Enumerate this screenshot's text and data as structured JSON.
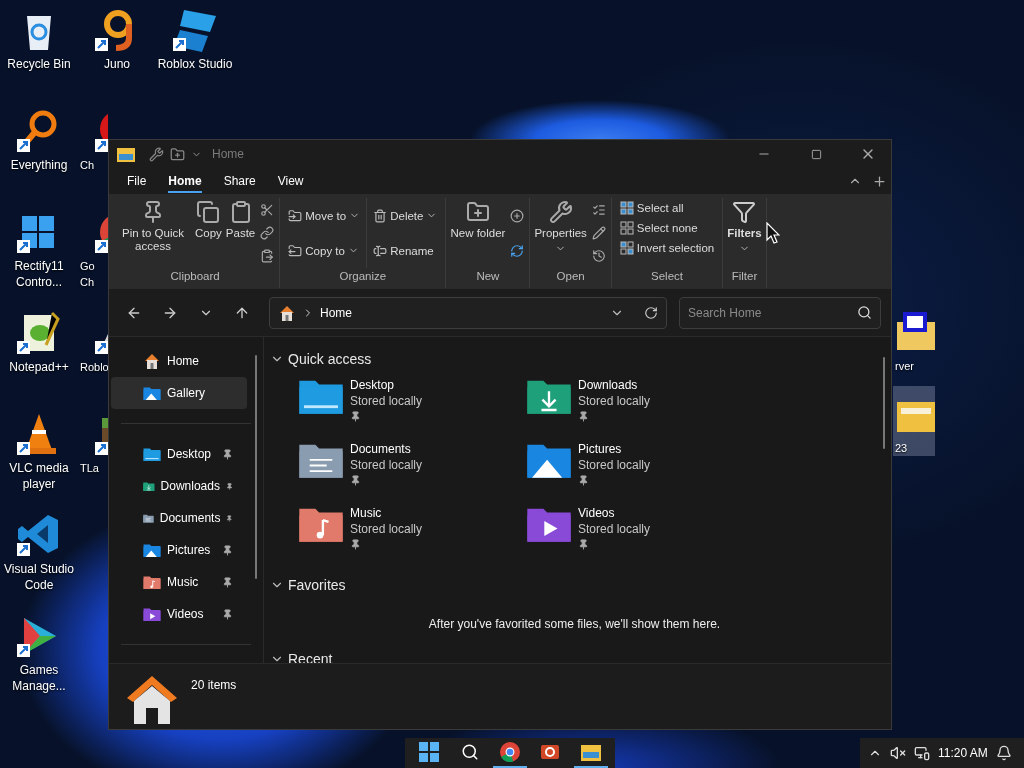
{
  "desktop": {
    "columns": [
      [
        {
          "label": "Recycle Bin",
          "kind": "bin",
          "shortcut": false,
          "clipped": false
        },
        {
          "label": "Everything",
          "kind": "everything",
          "shortcut": true,
          "clipped": false
        },
        {
          "label": "Rectify11 Contro...",
          "kind": "windows",
          "shortcut": true,
          "clipped": false
        },
        {
          "label": "Notepad++",
          "kind": "notepad",
          "shortcut": true,
          "clipped": false
        },
        {
          "label": "VLC media player",
          "kind": "vlc",
          "shortcut": true,
          "clipped": false
        },
        {
          "label": "Visual Studio Code",
          "kind": "vscode",
          "shortcut": true,
          "clipped": false
        },
        {
          "label": "Games Manage...",
          "kind": "games",
          "shortcut": true,
          "clipped": false
        }
      ],
      [
        {
          "label": "Juno",
          "kind": "juno",
          "shortcut": true,
          "clipped": false
        },
        {
          "label": "Ch",
          "kind": "red",
          "shortcut": true,
          "clipped": true
        },
        {
          "label": "Go Ch",
          "kind": "chrome",
          "shortcut": true,
          "clipped": true
        },
        {
          "label": "Roblo",
          "kind": "triangle",
          "shortcut": true,
          "clipped": true
        },
        {
          "label": "TLa",
          "kind": "cube",
          "shortcut": true,
          "clipped": true
        }
      ],
      [
        {
          "label": "Roblox Studio",
          "kind": "roblox",
          "shortcut": true,
          "clipped": false
        }
      ]
    ],
    "right_edge": [
      {
        "label": "rver",
        "kind": "zfolder",
        "selected": false
      },
      {
        "label": "23",
        "kind": "folder",
        "selected": true
      }
    ]
  },
  "window": {
    "title": "Home",
    "tabs": [
      {
        "label": "File",
        "selected": false
      },
      {
        "label": "Home",
        "selected": true
      },
      {
        "label": "Share",
        "selected": false
      },
      {
        "label": "View",
        "selected": false
      }
    ],
    "ribbon": [
      {
        "label": "Clipboard",
        "kind": "clipboard",
        "buttons": [
          "Pin to Quick access",
          "Copy",
          "Paste"
        ]
      },
      {
        "label": "Organize",
        "kind": "organize",
        "buttons": [
          "Move to",
          "Copy to",
          "Delete",
          "Rename"
        ]
      },
      {
        "label": "New",
        "kind": "new",
        "buttons": [
          "New folder"
        ]
      },
      {
        "label": "Open",
        "kind": "open",
        "buttons": [
          "Properties"
        ]
      },
      {
        "label": "Select",
        "kind": "select",
        "buttons": [
          "Select all",
          "Select none",
          "Invert selection"
        ]
      },
      {
        "label": "Filter",
        "kind": "filter",
        "buttons": [
          "Filters"
        ]
      }
    ],
    "address": {
      "location": "Home"
    },
    "search": {
      "placeholder": "Search Home"
    },
    "sidebar": {
      "groups": [
        {
          "items": [
            {
              "label": "Home",
              "kind": "home",
              "selected": false,
              "pinned": false
            },
            {
              "label": "Gallery",
              "kind": "pictures",
              "selected": true,
              "pinned": false
            }
          ]
        },
        {
          "items": [
            {
              "label": "Desktop",
              "kind": "desktop",
              "selected": false,
              "pinned": true
            },
            {
              "label": "Downloads",
              "kind": "downloads",
              "selected": false,
              "pinned": true
            },
            {
              "label": "Documents",
              "kind": "documents",
              "selected": false,
              "pinned": true
            },
            {
              "label": "Pictures",
              "kind": "pictures",
              "selected": false,
              "pinned": true
            },
            {
              "label": "Music",
              "kind": "music",
              "selected": false,
              "pinned": true
            },
            {
              "label": "Videos",
              "kind": "videos",
              "selected": false,
              "pinned": true
            }
          ]
        }
      ]
    },
    "sections": [
      {
        "title": "Quick access",
        "expanded": true,
        "folders": [
          {
            "name": "Desktop",
            "status": "Stored locally",
            "kind": "desktop",
            "pinned": true
          },
          {
            "name": "Downloads",
            "status": "Stored locally",
            "kind": "downloads",
            "pinned": true
          },
          {
            "name": "Documents",
            "status": "Stored locally",
            "kind": "documents",
            "pinned": true
          },
          {
            "name": "Pictures",
            "status": "Stored locally",
            "kind": "pictures",
            "pinned": true
          },
          {
            "name": "Music",
            "status": "Stored locally",
            "kind": "music",
            "pinned": true
          },
          {
            "name": "Videos",
            "status": "Stored locally",
            "kind": "videos",
            "pinned": true
          }
        ]
      },
      {
        "title": "Favorites",
        "expanded": true,
        "message": "After you've favorited some files, we'll show them here."
      },
      {
        "title": "Recent",
        "expanded": true
      }
    ],
    "status_bar": {
      "count": "20 items"
    }
  },
  "taskbar": {
    "apps": [
      {
        "kind": "start",
        "running": false
      },
      {
        "kind": "search",
        "running": false
      },
      {
        "kind": "chrome",
        "running": true
      },
      {
        "kind": "powerpoint",
        "running": false
      },
      {
        "kind": "explorer",
        "running": true
      }
    ],
    "time": "11:20 AM"
  }
}
